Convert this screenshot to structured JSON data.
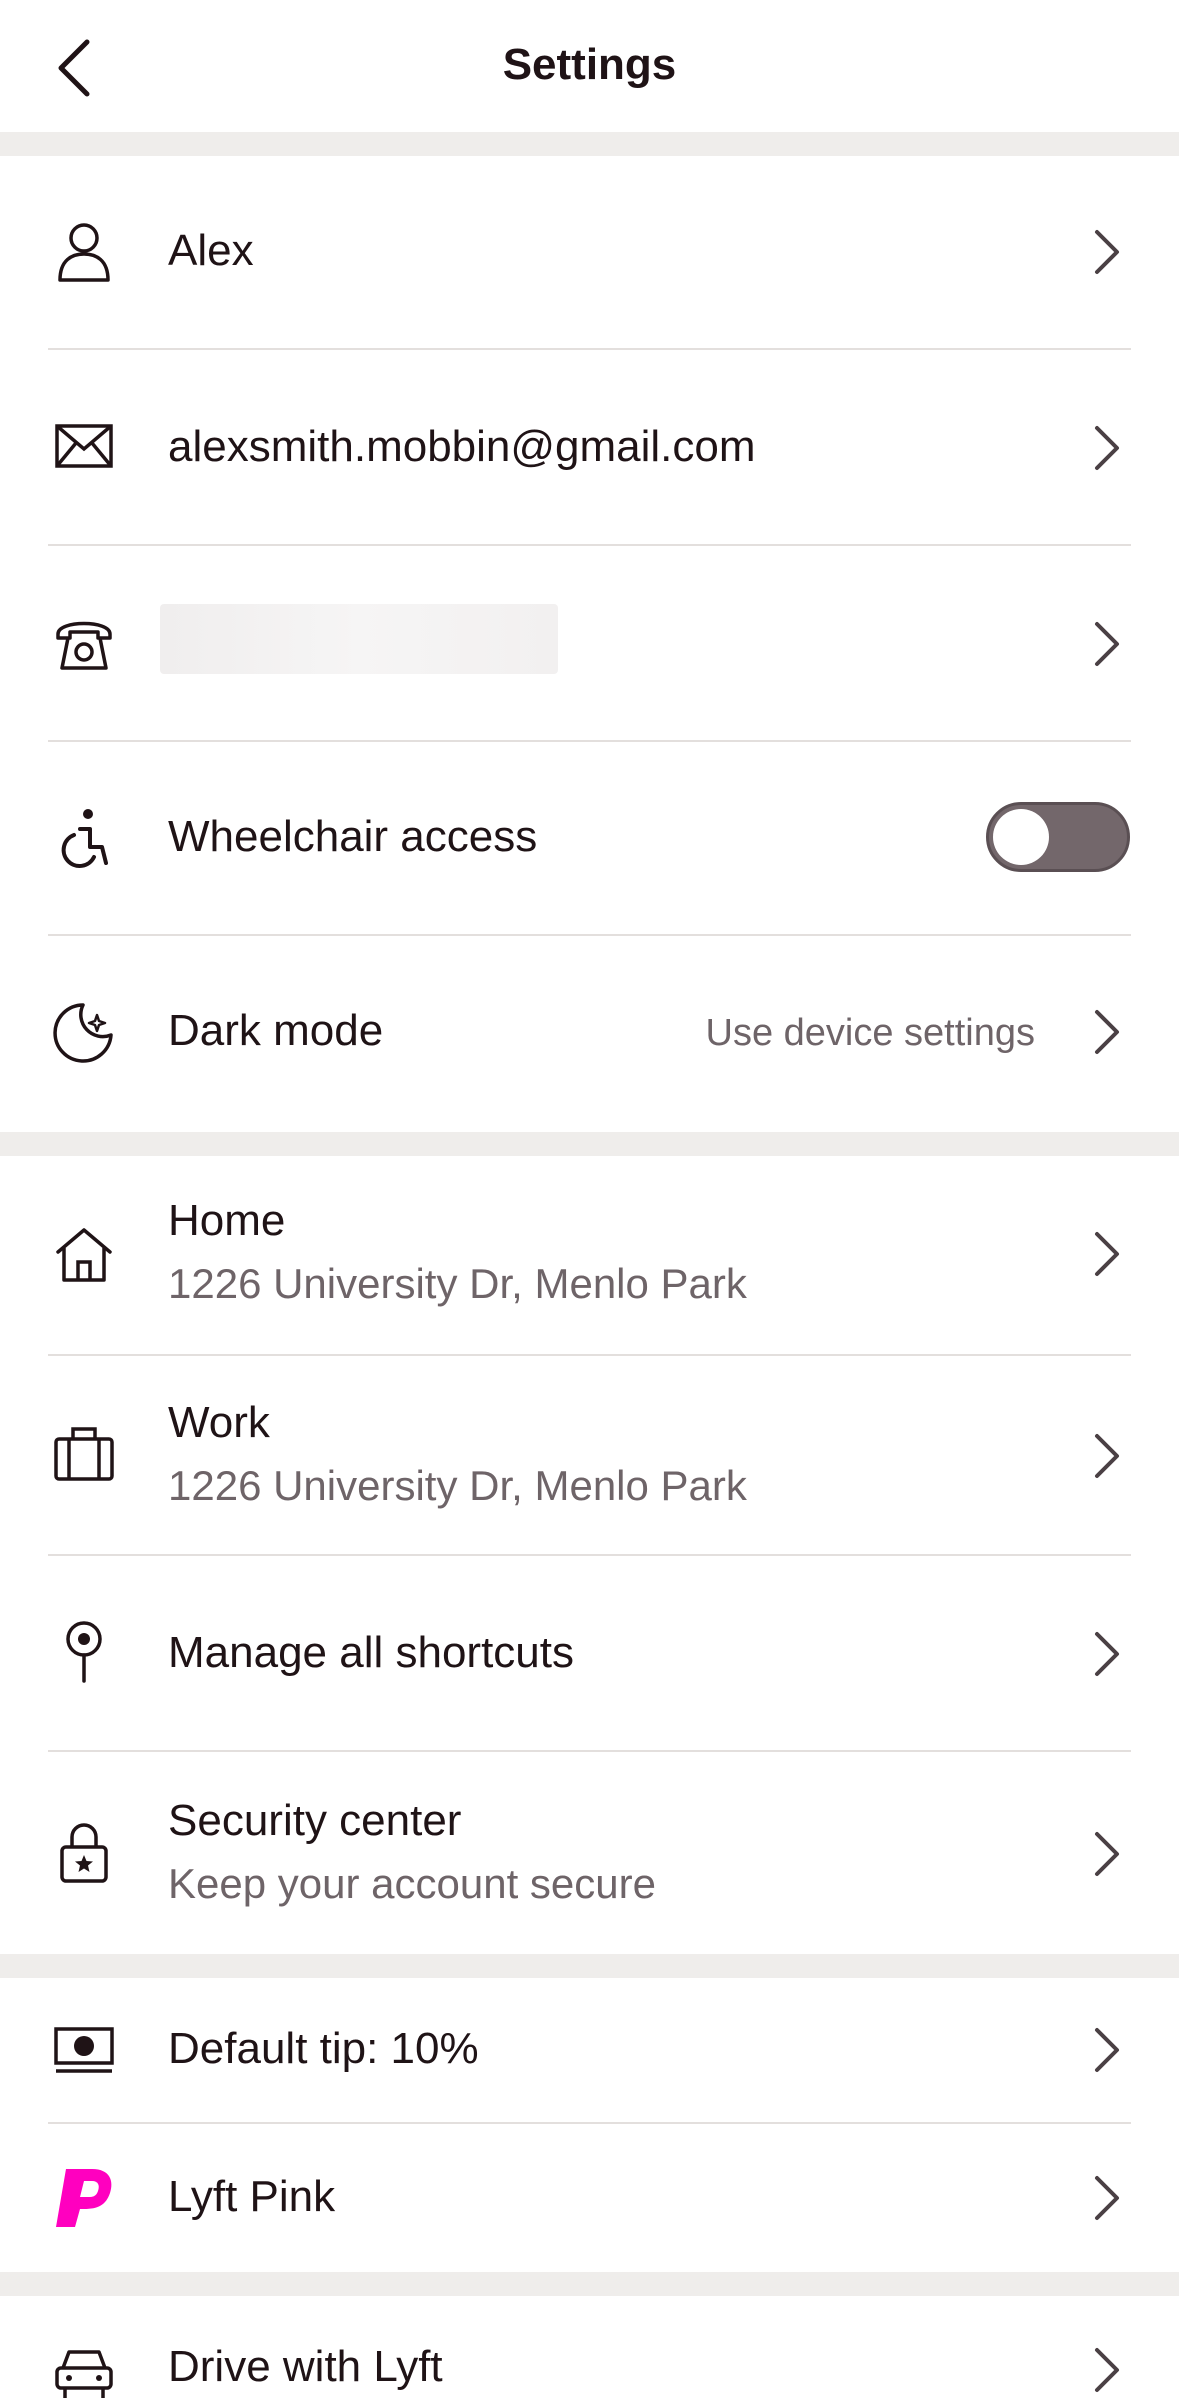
{
  "header": {
    "title": "Settings"
  },
  "account": {
    "name": "Alex",
    "email": "alexsmith.mobbin@gmail.com",
    "phone": "",
    "wheelchair_label": "Wheelchair access",
    "wheelchair_on": false,
    "dark_mode_label": "Dark mode",
    "dark_mode_value": "Use device settings"
  },
  "places": {
    "home_label": "Home",
    "home_address": "1226 University Dr, Menlo Park",
    "work_label": "Work",
    "work_address": "1226 University Dr, Menlo Park",
    "shortcuts_label": "Manage all shortcuts",
    "security_label": "Security center",
    "security_sub": "Keep your account secure"
  },
  "payments": {
    "tip_label": "Default tip: 10%",
    "pink_label": "Lyft Pink"
  },
  "other": {
    "drive_label": "Drive with Lyft"
  },
  "colors": {
    "brand_pink": "#ff00bf",
    "toggle_off": "#73676b",
    "section_bg": "#efedeb"
  }
}
